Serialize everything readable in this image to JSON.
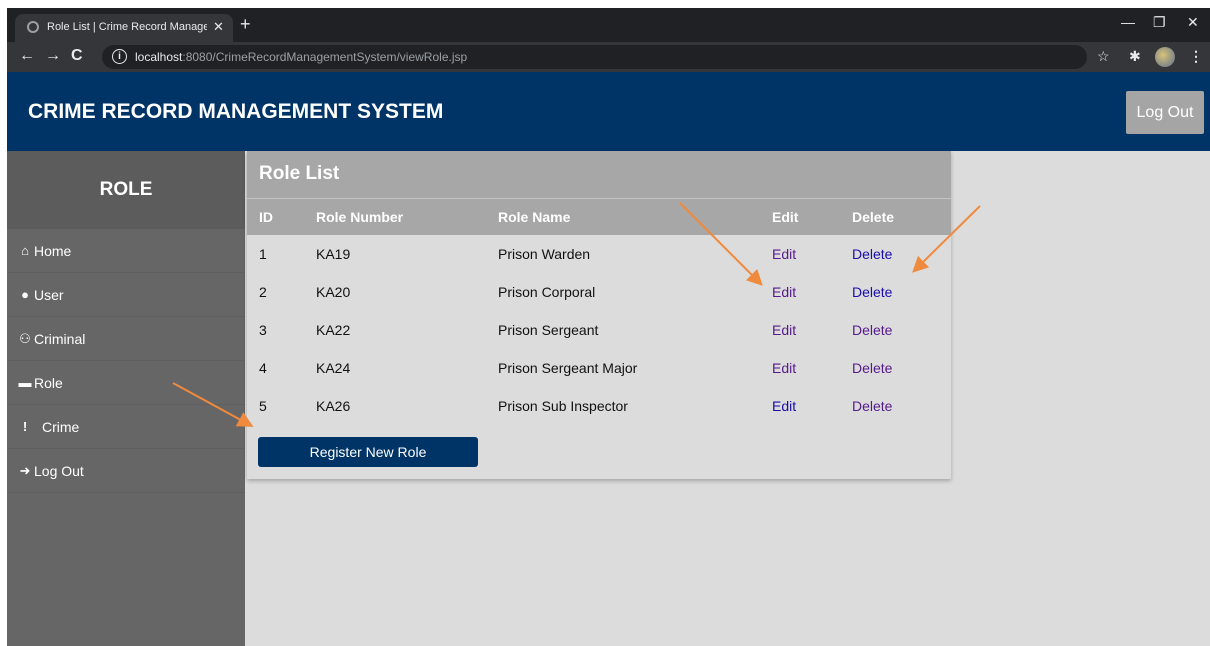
{
  "browser": {
    "tab_title": "Role List | Crime Record Manageme",
    "tab_close": "✕",
    "new_tab": "+",
    "url_host": "localhost",
    "url_rest": ":8080/CrimeRecordManagementSystem/viewRole.jsp"
  },
  "header": {
    "title": "CRIME RECORD MANAGEMENT SYSTEM",
    "logout_label": "Log Out"
  },
  "sidebar": {
    "heading": "ROLE",
    "items": [
      {
        "label": "Home",
        "icon": "home-icon",
        "glyph": "⌂"
      },
      {
        "label": "User",
        "icon": "user-icon",
        "glyph": "●"
      },
      {
        "label": "Criminal",
        "icon": "users-icon",
        "glyph": "⚇"
      },
      {
        "label": "Role",
        "icon": "briefcase-icon",
        "glyph": "▬"
      },
      {
        "label": "Crime",
        "icon": "exclamation-icon",
        "glyph": "!"
      },
      {
        "label": "Log Out",
        "icon": "sign-out-icon",
        "glyph": "➜"
      }
    ]
  },
  "role_list": {
    "title": "Role List",
    "columns": [
      "ID",
      "Role Number",
      "Role Name",
      "Edit",
      "Delete"
    ],
    "rows": [
      {
        "id": "1",
        "number": "KA19",
        "name": "Prison Warden",
        "edit": "Edit",
        "delete": "Delete"
      },
      {
        "id": "2",
        "number": "KA20",
        "name": "Prison Corporal",
        "edit": "Edit",
        "delete": "Delete"
      },
      {
        "id": "3",
        "number": "KA22",
        "name": "Prison Sergeant",
        "edit": "Edit",
        "delete": "Delete"
      },
      {
        "id": "4",
        "number": "KA24",
        "name": "Prison Sergeant Major",
        "edit": "Edit",
        "delete": "Delete"
      },
      {
        "id": "5",
        "number": "KA26",
        "name": "Prison Sub Inspector",
        "edit": "Edit",
        "delete": "Delete"
      }
    ],
    "register_label": "Register New Role"
  },
  "colors": {
    "header_bg": "#003366",
    "sidebar_bg": "#666666",
    "panel_header_bg": "#a7a7a7",
    "annotation_arrow": "#f08a3c"
  }
}
